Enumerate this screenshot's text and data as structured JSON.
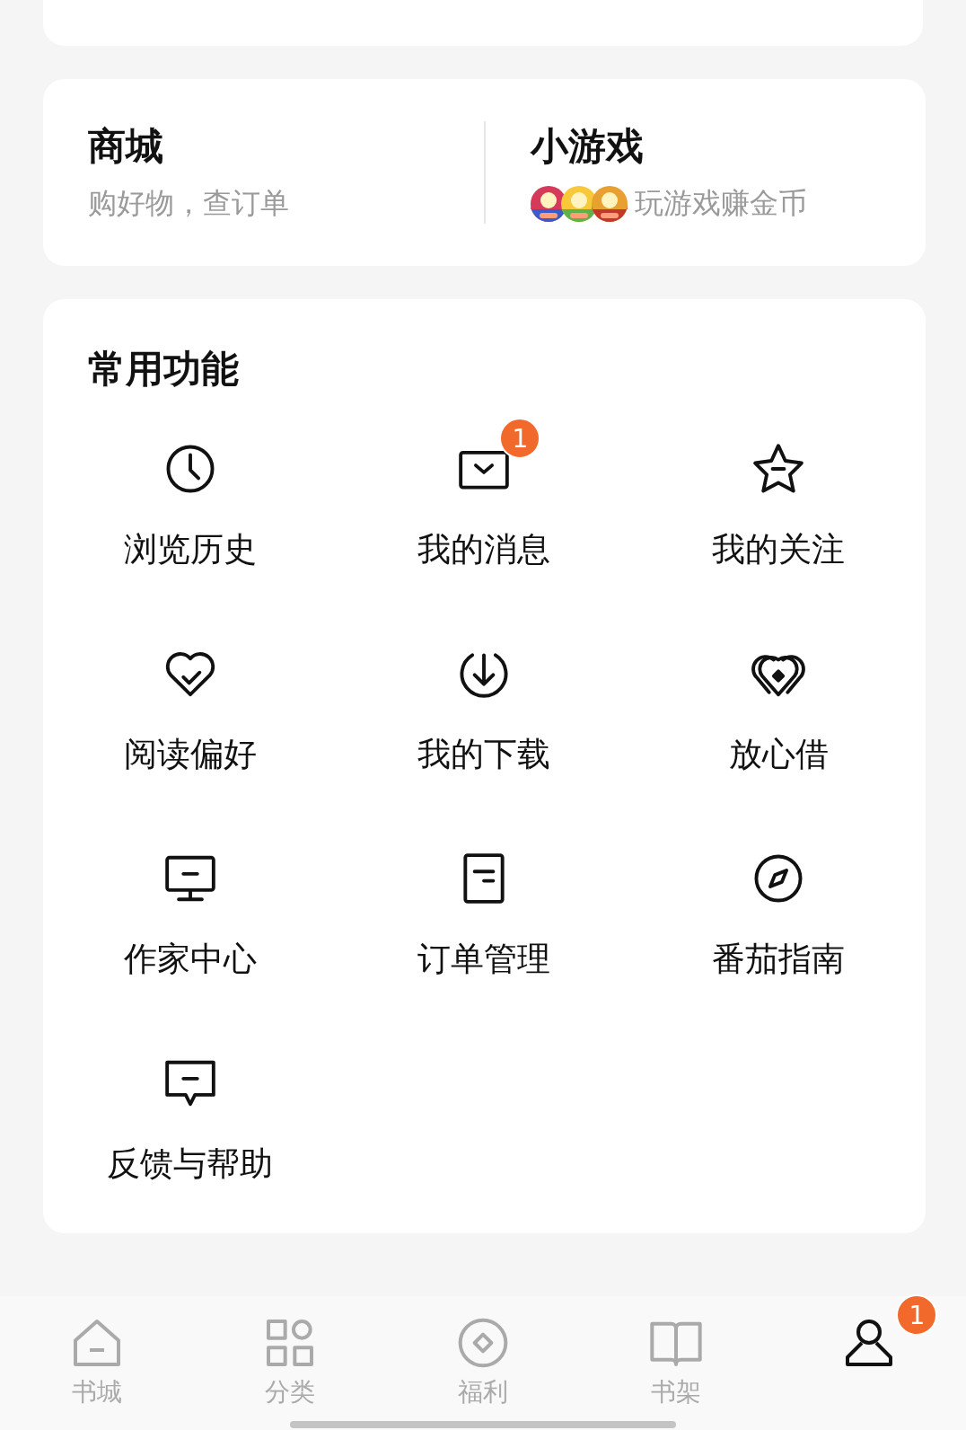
{
  "shortcuts": [
    {
      "title": "商城",
      "subtitle": "购好物，查订单"
    },
    {
      "title": "小游戏",
      "subtitle": "玩游戏赚金币"
    }
  ],
  "functions": {
    "title": "常用功能",
    "items": [
      {
        "label": "浏览历史"
      },
      {
        "label": "我的消息",
        "badge": "1"
      },
      {
        "label": "我的关注"
      },
      {
        "label": "阅读偏好"
      },
      {
        "label": "我的下载"
      },
      {
        "label": "放心借"
      },
      {
        "label": "作家中心"
      },
      {
        "label": "订单管理"
      },
      {
        "label": "番茄指南"
      },
      {
        "label": "反馈与帮助"
      }
    ]
  },
  "tab_bar": [
    {
      "label": "书城",
      "selected": false
    },
    {
      "label": "分类",
      "selected": false
    },
    {
      "label": "福利",
      "selected": false
    },
    {
      "label": "书架",
      "selected": false
    },
    {
      "selected": true,
      "badge": "1"
    }
  ]
}
